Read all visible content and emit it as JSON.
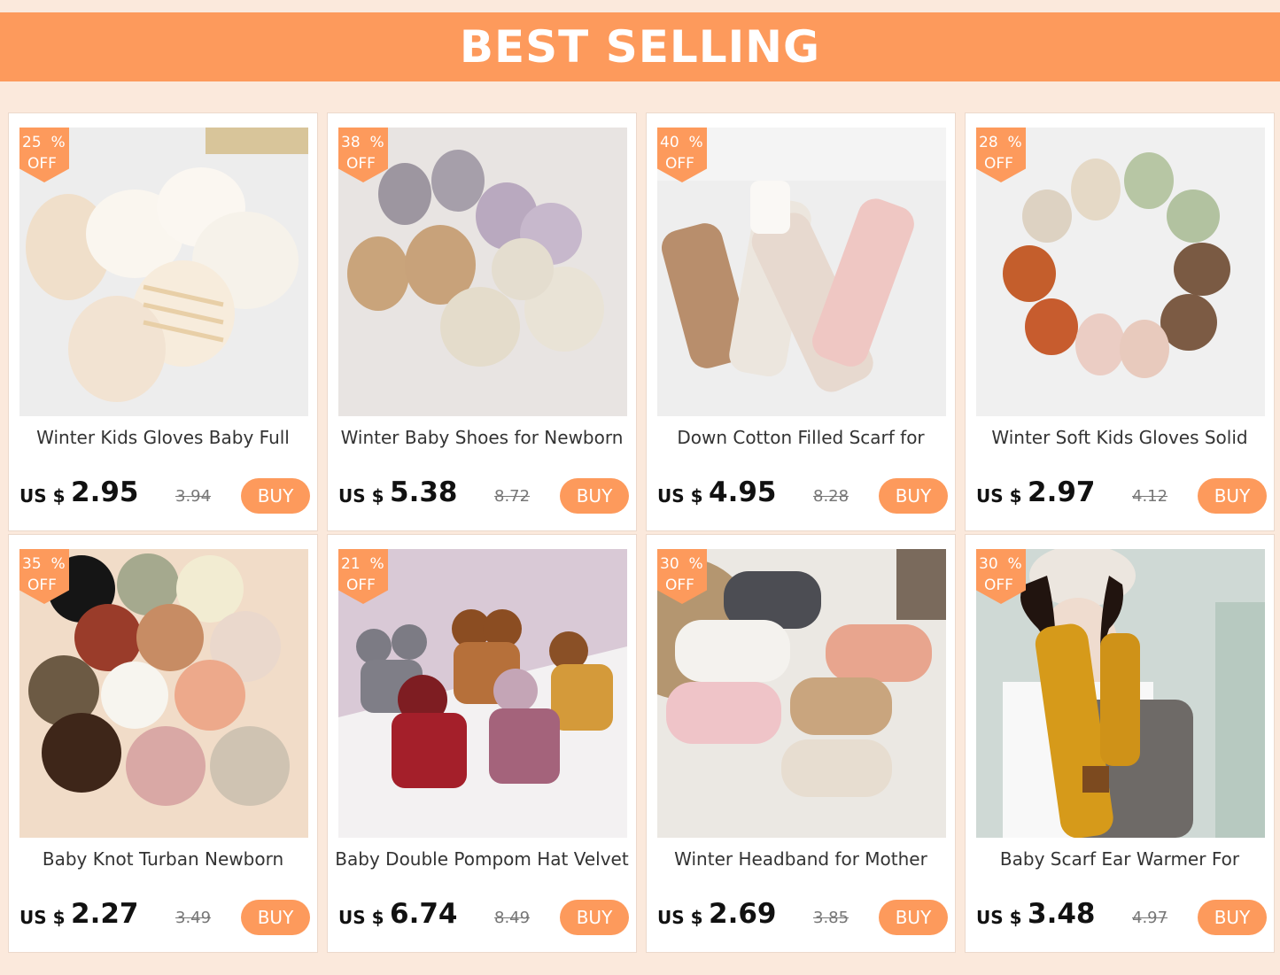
{
  "banner": {
    "title": "BEST SELLING"
  },
  "products": [
    {
      "discount": "25  %",
      "off": "OFF",
      "title": "Winter Kids Gloves Baby Full",
      "currency": "US $",
      "price": "2.95",
      "old_price": "3.94",
      "buy": "BUY",
      "image": "baby-mittens"
    },
    {
      "discount": "38  %",
      "off": "OFF",
      "title": "Winter Baby Shoes for Newborn",
      "currency": "US $",
      "price": "5.38",
      "old_price": "8.72",
      "buy": "BUY",
      "image": "plush-baby-shoes"
    },
    {
      "discount": "40  %",
      "off": "OFF",
      "title": "Down Cotton Filled Scarf for",
      "currency": "US $",
      "price": "4.95",
      "old_price": "8.28",
      "buy": "BUY",
      "image": "puffer-scarves"
    },
    {
      "discount": "28  %",
      "off": "OFF",
      "title": "Winter Soft Kids Gloves Solid",
      "currency": "US $",
      "price": "2.97",
      "old_price": "4.12",
      "buy": "BUY",
      "image": "teddy-gloves-circle"
    },
    {
      "discount": "35  %",
      "off": "OFF",
      "title": "Baby Knot Turban Newborn",
      "currency": "US $",
      "price": "2.27",
      "old_price": "3.49",
      "buy": "BUY",
      "image": "knot-turbans"
    },
    {
      "discount": "21  %",
      "off": "OFF",
      "title": "Baby Double Pompom Hat Velvet",
      "currency": "US $",
      "price": "6.74",
      "old_price": "8.49",
      "buy": "BUY",
      "image": "pompom-hats"
    },
    {
      "discount": "30  %",
      "off": "OFF",
      "title": "Winter Headband for Mother",
      "currency": "US $",
      "price": "2.69",
      "old_price": "3.85",
      "buy": "BUY",
      "image": "fleece-headbands"
    },
    {
      "discount": "30  %",
      "off": "OFF",
      "title": "Baby Scarf Ear Warmer For",
      "currency": "US $",
      "price": "3.48",
      "old_price": "4.97",
      "buy": "BUY",
      "image": "girl-knit-scarf"
    }
  ],
  "colors": {
    "accent": "#fd9a5c",
    "background": "#fbe9dc"
  }
}
